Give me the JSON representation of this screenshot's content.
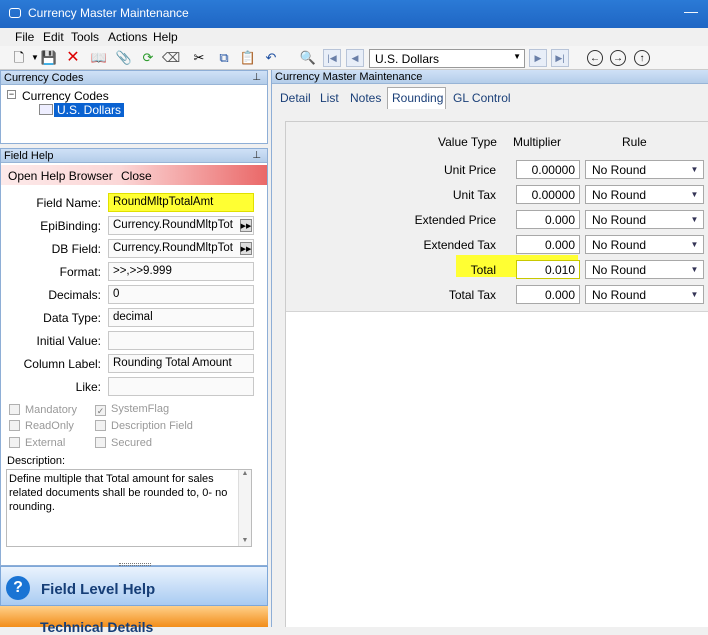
{
  "window": {
    "title": "Currency Master Maintenance"
  },
  "menu": [
    "File",
    "Edit",
    "Tools",
    "Actions",
    "Help"
  ],
  "toolbar": {
    "currency_selector": "U.S. Dollars"
  },
  "left_tree": {
    "header": "Currency Codes",
    "root": "Currency Codes",
    "child": "U.S. Dollars"
  },
  "field_help": {
    "header": "Field Help",
    "open_help_browser": "Open Help Browser",
    "close": "Close",
    "fields": [
      {
        "label": "Field Name:",
        "value": "RoundMltpTotalAmt"
      },
      {
        "label": "EpiBinding:",
        "value": "Currency.RoundMltpTot"
      },
      {
        "label": "DB Field:",
        "value": "Currency.RoundMltpTot"
      },
      {
        "label": "Format:",
        "value": ">>,>>9.999"
      },
      {
        "label": "Decimals:",
        "value": "0"
      },
      {
        "label": "Data Type:",
        "value": "decimal"
      },
      {
        "label": "Initial Value:",
        "value": ""
      },
      {
        "label": "Column Label:",
        "value": "Rounding Total Amount"
      },
      {
        "label": "Like:",
        "value": ""
      }
    ],
    "checkboxes": {
      "mandatory": "Mandatory",
      "system_flag": "SystemFlag",
      "read_only": "ReadOnly",
      "description_field": "Description Field",
      "external": "External",
      "secured": "Secured"
    },
    "description_label": "Description:",
    "description": "Define multiple that Total amount for sales related documents shall be rounded to, 0- no rounding.",
    "field_level_help": "Field Level Help",
    "technical_details": "Technical Details"
  },
  "right_pane": {
    "header": "Currency Master Maintenance",
    "tabs": [
      "Detail",
      "List",
      "Notes",
      "Rounding",
      "GL Control"
    ],
    "active_tab": "Rounding",
    "columns": {
      "value_type": "Value Type",
      "multiplier": "Multiplier",
      "rule": "Rule"
    },
    "rows": [
      {
        "label": "Unit Price",
        "multiplier": "0.00000",
        "rule": "No Round"
      },
      {
        "label": "Unit Tax",
        "multiplier": "0.00000",
        "rule": "No Round"
      },
      {
        "label": "Extended Price",
        "multiplier": "0.000",
        "rule": "No Round"
      },
      {
        "label": "Extended Tax",
        "multiplier": "0.000",
        "rule": "No Round"
      },
      {
        "label": "Total",
        "multiplier": "0.010",
        "rule": "No Round"
      },
      {
        "label": "Total Tax",
        "multiplier": "0.000",
        "rule": "No Round"
      }
    ]
  },
  "colors": {
    "highlight": "#ffff33",
    "titlebar": "#2b7ad6",
    "selection": "#0a62d1"
  }
}
